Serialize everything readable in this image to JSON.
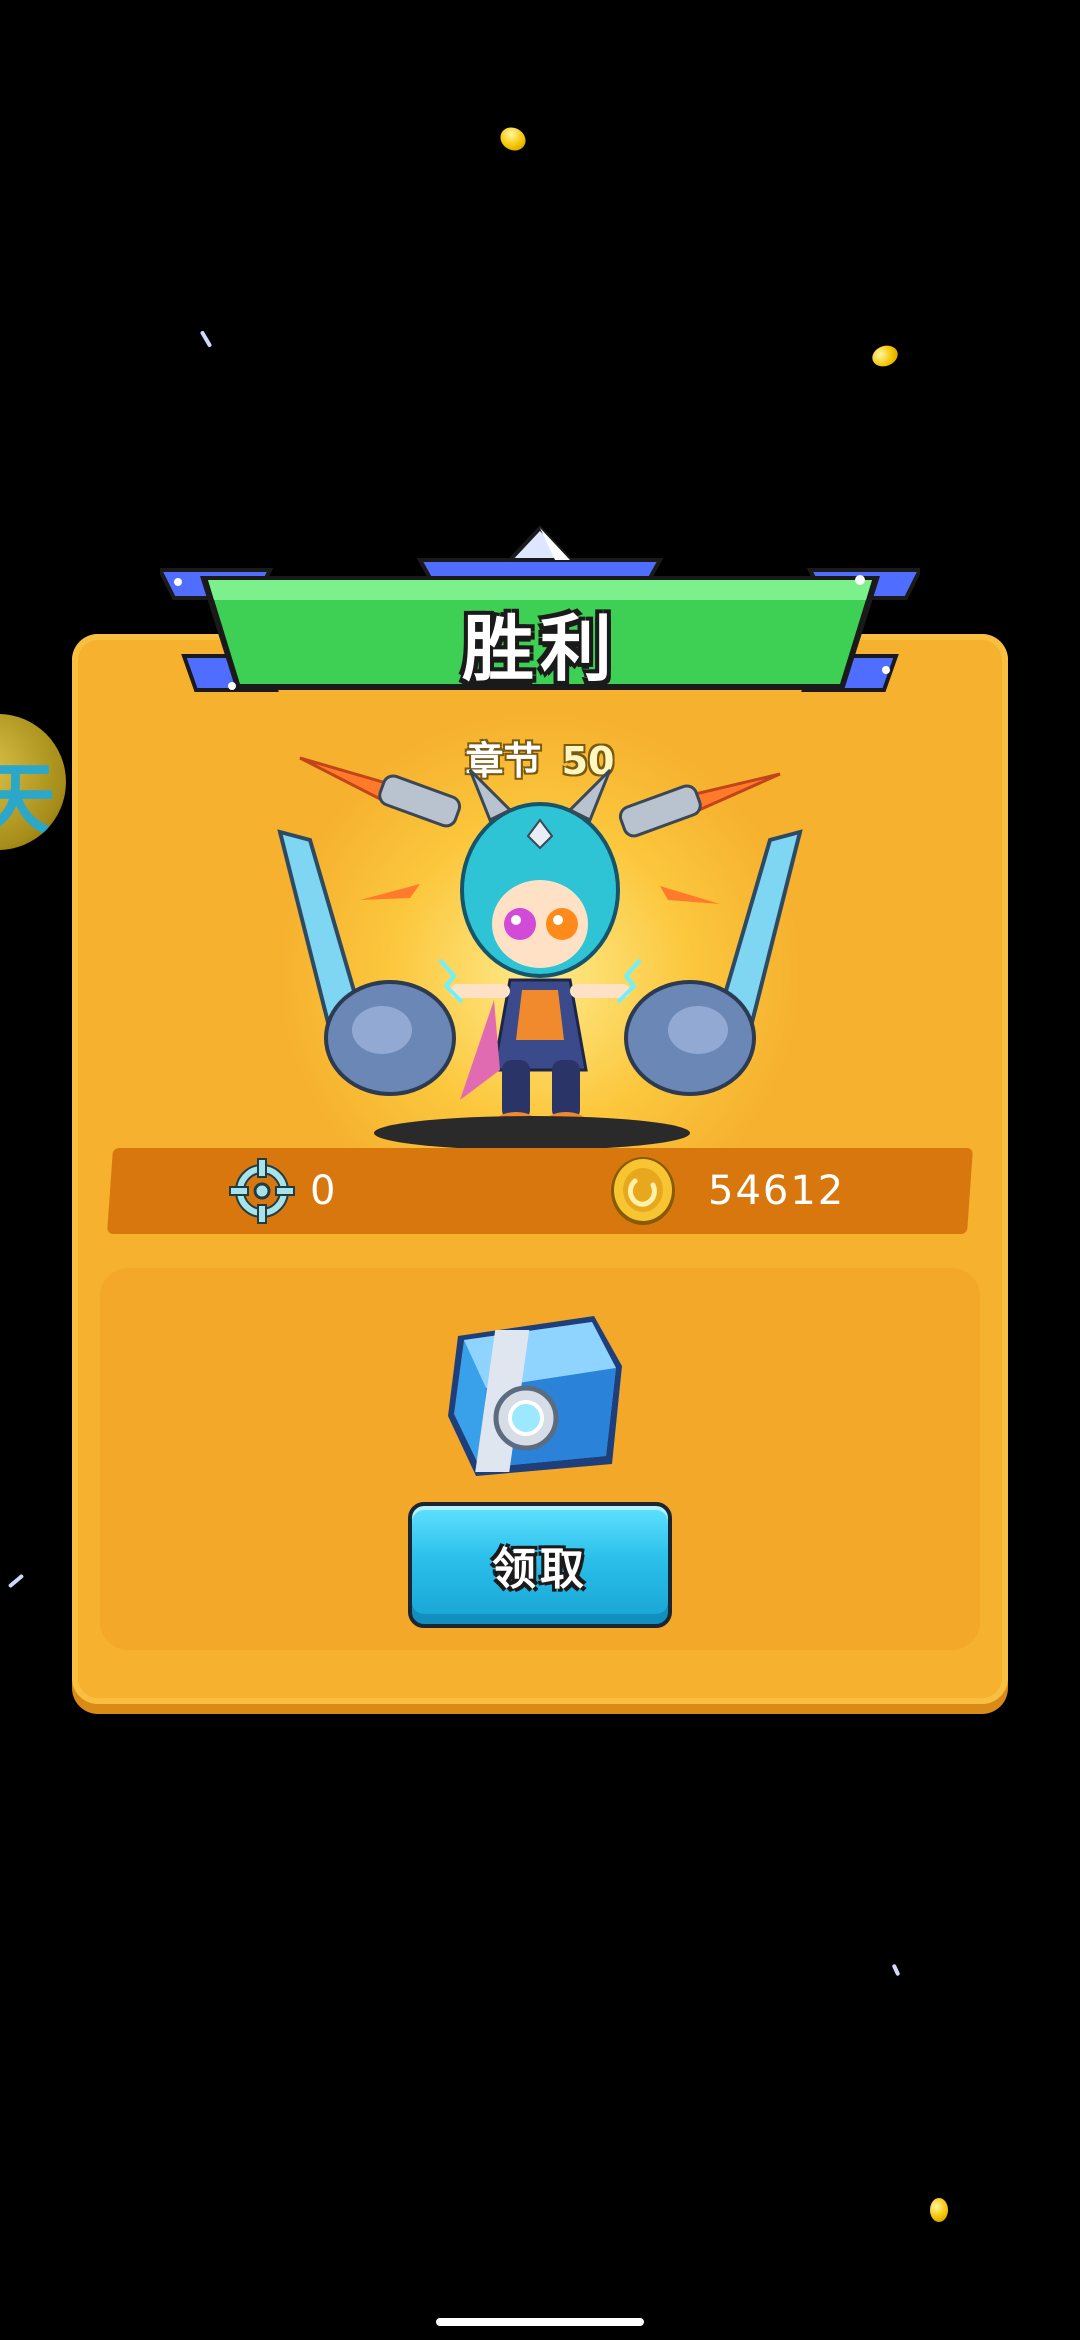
{
  "banner": {
    "title": "胜利"
  },
  "chapter": {
    "label": "章节",
    "number": "50"
  },
  "stats": {
    "kills": "0",
    "coins": "54612"
  },
  "reward": {
    "claim_label": "领取"
  },
  "side_badge": {
    "glyph": "天"
  },
  "colors": {
    "panel": "#f6b12f",
    "banner_green": "#3ecf55",
    "banner_blue": "#4f6dff",
    "claim_button": "#2bbfea",
    "stats_strip": "#d9770f"
  },
  "icons": {
    "kills": "crosshair-icon",
    "coins": "gold-coin-icon",
    "reward": "treasure-chest-icon"
  }
}
